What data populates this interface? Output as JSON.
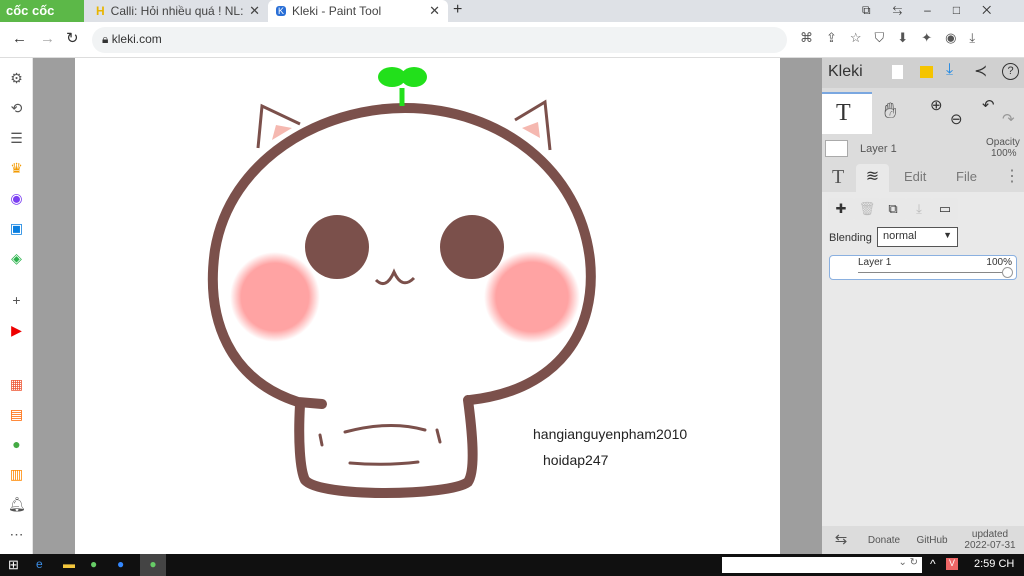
{
  "browser": {
    "brand": "cốc cốc",
    "tabs": [
      {
        "label": "Calli: Hỏi nhiều quá ! NL: Đố"
      },
      {
        "label": "Kleki - Paint Tool"
      }
    ],
    "url": "kleki.com"
  },
  "canvas": {
    "texts": [
      "hangianguyenpham2010",
      "hoidap247"
    ],
    "colors": {
      "outline": "#7b504b",
      "blush": "#ffa3a3",
      "sprout": "#22e01b"
    }
  },
  "panel": {
    "logo": "Kleki",
    "layer_name": "Layer 1",
    "opacity_label": "Opacity",
    "opacity_value": "100%",
    "tabs": [
      "Edit",
      "File"
    ],
    "blending_label": "Blending",
    "blending_value": "normal",
    "layers": [
      {
        "name": "Layer 1",
        "opacity": "100%"
      }
    ],
    "footer": {
      "donate": "Donate",
      "github": "GitHub",
      "updated": "updated",
      "date": "2022-07-31"
    }
  },
  "taskbar": {
    "time": "2:59 CH"
  }
}
